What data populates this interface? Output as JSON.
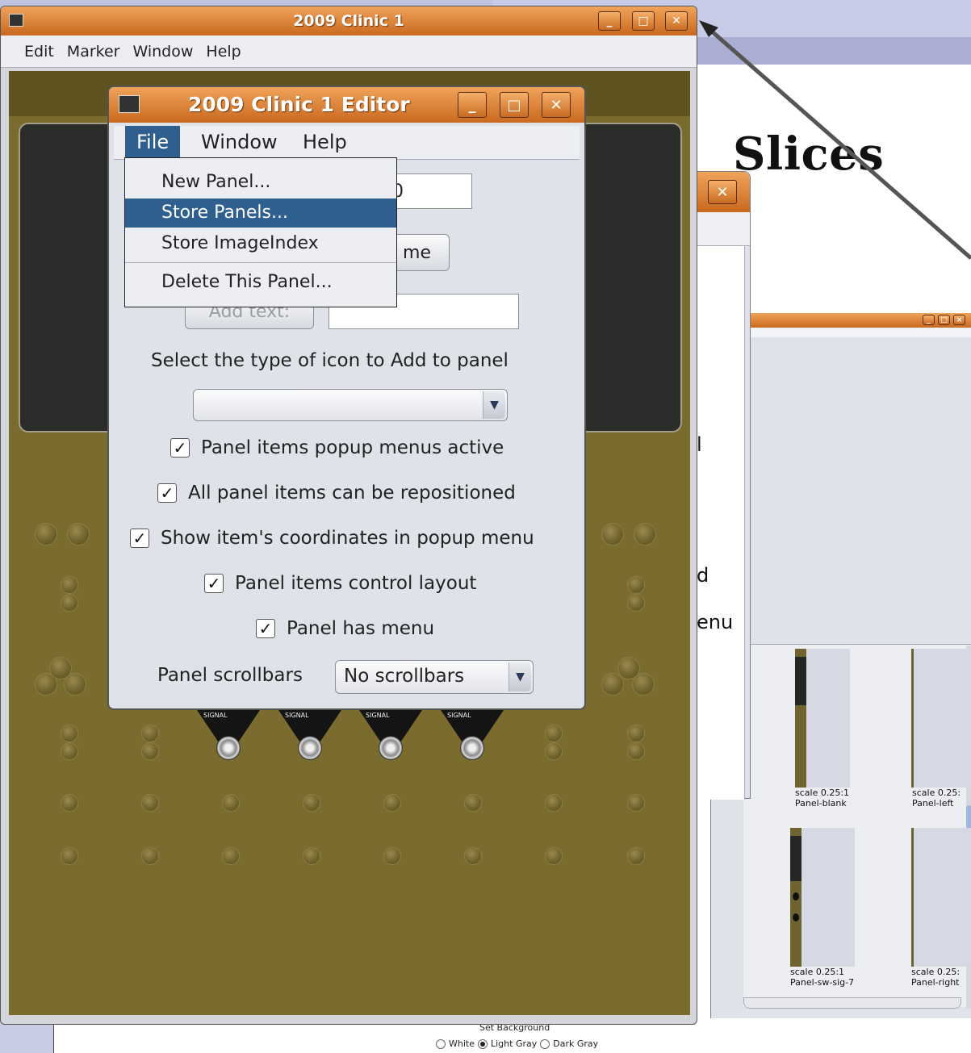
{
  "slide": {
    "title": "Slices",
    "set_background": {
      "title": "Set Background",
      "options": [
        "White",
        "Light Gray",
        "Dark Gray"
      ],
      "selected": "Light Gray"
    }
  },
  "main_window": {
    "title": "2009 Clinic 1",
    "menu": [
      "Edit",
      "Marker",
      "Window",
      "Help"
    ],
    "signal_label": "SIGNAL"
  },
  "editor_window": {
    "title": "2009 Clinic 1 Editor",
    "menu": [
      "File",
      "Window",
      "Help"
    ],
    "active_menu": "File",
    "file_menu": [
      "New Panel...",
      "Store Panels...",
      "Store ImageIndex",
      "Delete This Panel..."
    ],
    "highlighted_item": "Store Panels...",
    "field_partial": "0",
    "button_partial": "me",
    "add_text_button": "Add text:",
    "icon_type_label": "Select the type of icon to Add to panel",
    "icon_type_value": "",
    "checkboxes": [
      {
        "label": "Panel items popup menus active",
        "checked": true
      },
      {
        "label": "All panel items can be repositioned",
        "checked": true
      },
      {
        "label": "Show item's coordinates in popup menu",
        "checked": true
      },
      {
        "label": "Panel items control layout",
        "checked": true
      },
      {
        "label": "Panel has menu",
        "checked": true
      }
    ],
    "scrollbars_label": "Panel scrollbars",
    "scrollbars_value": "No scrollbars"
  },
  "middle_window": {
    "partial_texts": [
      "l",
      "d",
      "enu"
    ]
  },
  "catalog_window": {
    "items": [
      {
        "scale": "scale 0.25:1",
        "name": "Panel-blank"
      },
      {
        "scale": "scale 0.25:",
        "name": "Panel-left"
      },
      {
        "scale": "scale 0.25:1",
        "name": "Panel-sw-sig-7"
      },
      {
        "scale": "scale 0.25:",
        "name": "Panel-right"
      }
    ]
  },
  "icons": {
    "minimize": "minimize-icon",
    "maximize": "maximize-icon",
    "close": "close-icon",
    "app": "jmri-locomotive-icon",
    "dropdown": "chevron-down-icon",
    "check": "checkmark-icon"
  },
  "colors": {
    "titlebar": "#d77a2c",
    "panel": "#7a6c2e",
    "menu_highlight": "#2f5f8e"
  }
}
